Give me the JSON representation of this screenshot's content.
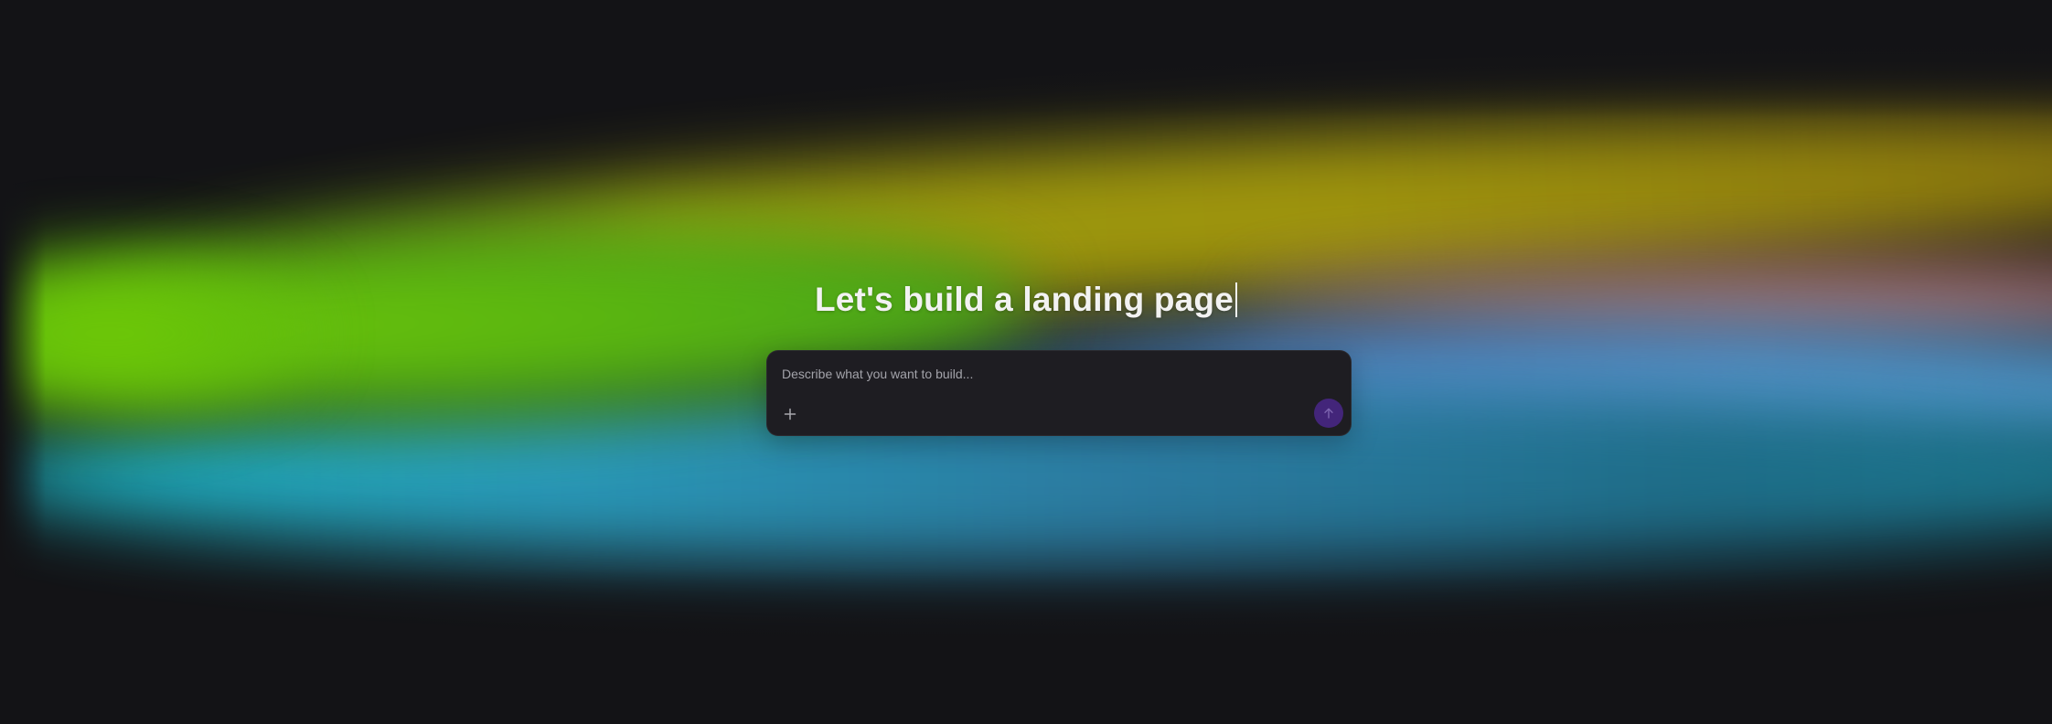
{
  "hero": {
    "headline": "Let's build a landing page"
  },
  "composer": {
    "placeholder": "Describe what you want to build...",
    "value": "",
    "attach_icon": "plus-icon",
    "send_icon": "arrow-up-icon"
  },
  "colors": {
    "background": "#131316",
    "composer_bg": "#1e1d22",
    "send_button": "#43257a",
    "headline_text": "#f2f2f2"
  }
}
